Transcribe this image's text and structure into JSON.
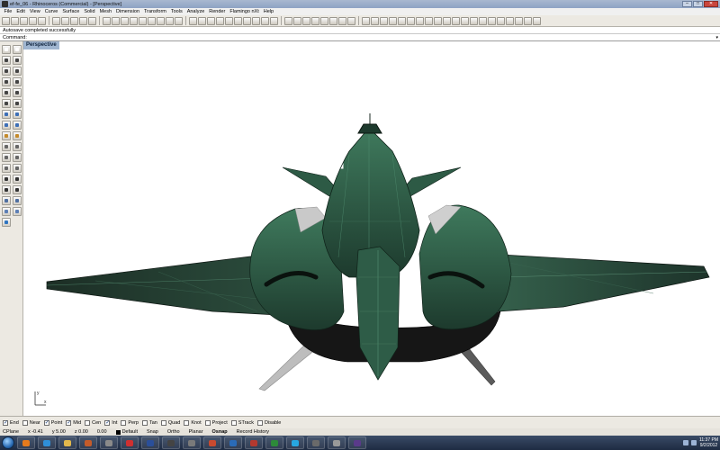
{
  "window": {
    "title": "ef-fe_06 - Rhinoceros (Commercial) - [Perspective]"
  },
  "menu": [
    "File",
    "Edit",
    "View",
    "Curve",
    "Surface",
    "Solid",
    "Mesh",
    "Dimension",
    "Transform",
    "Tools",
    "Analyze",
    "Render",
    "Flamingo nXt",
    "Help"
  ],
  "command_history": "Autosave completed successfully",
  "command_prompt": "Command",
  "viewport": {
    "label": "Perspective"
  },
  "axes": {
    "x": "x",
    "y": "y"
  },
  "osnaps": [
    {
      "label": "End",
      "checked": true
    },
    {
      "label": "Near",
      "checked": false
    },
    {
      "label": "Point",
      "checked": true
    },
    {
      "label": "Mid",
      "checked": true
    },
    {
      "label": "Cen",
      "checked": false
    },
    {
      "label": "Int",
      "checked": true
    },
    {
      "label": "Perp",
      "checked": false
    },
    {
      "label": "Tan",
      "checked": false
    },
    {
      "label": "Quad",
      "checked": false
    },
    {
      "label": "Knot",
      "checked": false
    },
    {
      "label": "Project",
      "checked": false
    },
    {
      "label": "STrack",
      "checked": false
    },
    {
      "label": "Disable",
      "checked": false
    }
  ],
  "status": {
    "cplane": "CPlane",
    "x": "x -0.41",
    "y": "y 5.00",
    "z": "z 0.00",
    "value": "0.00",
    "layer": "Default",
    "snap": "Snap",
    "ortho": "Ortho",
    "planar": "Planar",
    "osnap": "Osnap",
    "record": "Record History"
  },
  "clock": {
    "time": "11:37 PM",
    "date": "9/2/2012"
  },
  "colors": {
    "model_green": "#2f5e48",
    "model_dark": "#1a1a1a",
    "tab": "#9fb5d0"
  }
}
